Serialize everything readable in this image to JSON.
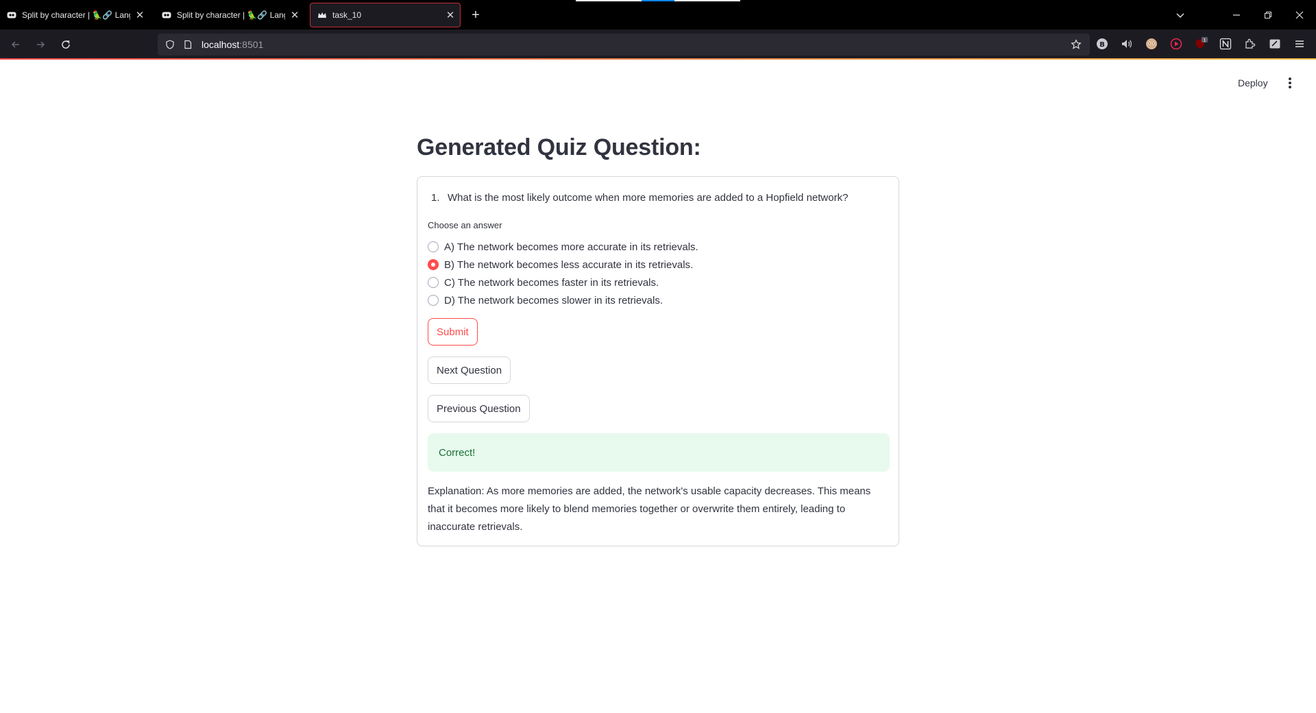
{
  "browser": {
    "tabs": [
      {
        "title": "Split by character | 🦜🔗 LangChain",
        "active": false
      },
      {
        "title": "Split by character | 🦜🔗 LangChain",
        "active": false
      },
      {
        "title": "task_10",
        "active": true
      }
    ],
    "url_host": "localhost",
    "url_port": ":8501",
    "extension_badge": "1"
  },
  "app": {
    "deploy_label": "Deploy",
    "page_title": "Generated Quiz Question:",
    "question_number": "1.",
    "question_text": "What is the most likely outcome when more memories are added to a Hopfield network?",
    "choose_label": "Choose an answer",
    "options": [
      "A) The network becomes more accurate in its retrievals.",
      "B) The network becomes less accurate in its retrievals.",
      "C) The network becomes faster in its retrievals.",
      "D) The network becomes slower in its retrievals."
    ],
    "selected_option": "B) The network becomes less accurate in its retrievals.",
    "submit_label": "Submit",
    "next_label": "Next Question",
    "previous_label": "Previous Question",
    "result_text": "Correct!",
    "explanation": "Explanation: As more memories are added, the network's usable capacity decreases. This means that it becomes more likely to blend memories together or overwrite them entirely, leading to inaccurate retrievals."
  },
  "colors": {
    "accent": "#ff4b4b",
    "success_bg": "#e8f9ee",
    "success_text": "#177233",
    "text": "#31333f"
  }
}
